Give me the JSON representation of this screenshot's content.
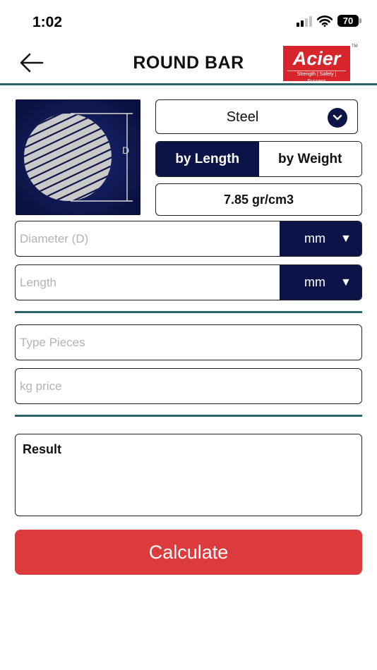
{
  "status_bar": {
    "time": "1:02",
    "battery": "70"
  },
  "header": {
    "title": "ROUND BAR"
  },
  "logo": {
    "name": "Acier",
    "tagline": "Strength | Safety | Success",
    "tm": "TM"
  },
  "diagram": {
    "label": "D"
  },
  "material": {
    "value": "Steel"
  },
  "mode": {
    "by_length": "by Length",
    "by_weight": "by Weight",
    "active": "by_length"
  },
  "density": {
    "value": "7.85 gr/cm3"
  },
  "diameter": {
    "placeholder": "Diameter (D)",
    "unit": "mm",
    "arrow": "▼"
  },
  "length": {
    "placeholder": "Length",
    "unit": "mm",
    "arrow": "▼"
  },
  "pieces": {
    "placeholder": "Type Pieces"
  },
  "kg_price": {
    "placeholder": "kg price"
  },
  "result": {
    "label": "Result"
  },
  "calculate": {
    "label": "Calculate"
  },
  "colors": {
    "navy": "#0c1447",
    "teal": "#2a6469",
    "red": "#dd3a3e",
    "brand_red": "#d8252b"
  }
}
